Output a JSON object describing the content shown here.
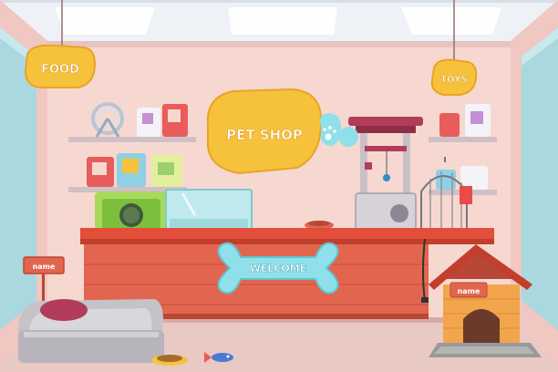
{
  "scene": {
    "signs": {
      "food": "FOOD",
      "toys": "TOYS",
      "pet_shop": "PET SHOP",
      "welcome": "WELCOME",
      "name_post": "name",
      "name_doghouse": "name"
    },
    "colors": {
      "wall": "#f6d8d0",
      "ceiling": "#f3e9ee",
      "floor": "#e9c9c4",
      "counter": "#e2664f",
      "counter_dark": "#b94737",
      "sign_yellow": "#f7c23b",
      "window": "#a9d8de",
      "bone": "#8fe0ea"
    }
  }
}
